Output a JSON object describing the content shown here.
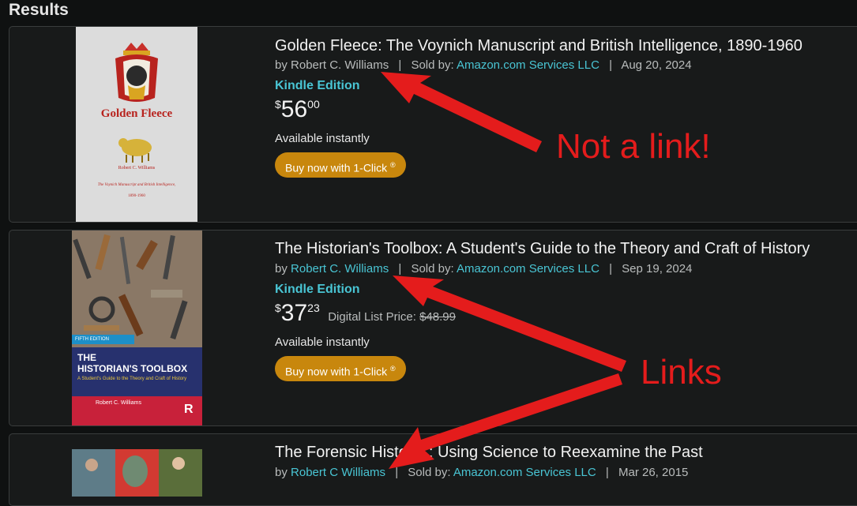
{
  "page": {
    "heading": "Results"
  },
  "results": [
    {
      "title": "Golden Fleece: The Voynich Manuscript and British Intelligence, 1890-1960",
      "by": "by",
      "author": "Robert C. Williams",
      "author_is_link": false,
      "sold_by_label": "Sold by:",
      "seller": "Amazon.com Services LLC",
      "date": "Aug 20, 2024",
      "format": "Kindle Edition",
      "price_symbol": "$",
      "price_whole": "56",
      "price_fraction": "00",
      "availability": "Available instantly",
      "buy_label": "Buy now with 1-Click",
      "buy_reg": "®",
      "cover": {
        "title": "Golden Fleece",
        "author": "Robert C. Williams",
        "subtitle": "The Voynich Manuscript and British Intelligence,",
        "years": "1890-1960"
      }
    },
    {
      "title": "The Historian's Toolbox: A Student's Guide to the Theory and Craft of History",
      "by": "by",
      "author": "Robert C. Williams",
      "author_is_link": true,
      "sold_by_label": "Sold by:",
      "seller": "Amazon.com Services LLC",
      "date": "Sep 19, 2024",
      "format": "Kindle Edition",
      "price_symbol": "$",
      "price_whole": "37",
      "price_fraction": "23",
      "list_price_label": "Digital List Price:",
      "list_price": "$48.99",
      "availability": "Available instantly",
      "buy_label": "Buy now with 1-Click",
      "buy_reg": "®",
      "cover": {
        "edition": "FIFTH EDITION",
        "title_line1": "THE",
        "title_line2": "HISTORIAN'S TOOLBOX",
        "subtitle": "A Student's Guide to the Theory and Craft of History",
        "author": "Robert C. Williams",
        "publisher_mark": "R"
      }
    },
    {
      "title": "The Forensic Historian: Using Science to Reexamine the Past",
      "title_visible_start": "The Forensic Histo",
      "title_visible_end": ": Using Science to Reexamine the Past",
      "by": "by",
      "author": "Robert C Williams",
      "author_is_link": true,
      "sold_by_label": "Sold by:",
      "seller": "Amazon.com Services LLC",
      "date": "Mar 26, 2015"
    }
  ],
  "annotations": {
    "not_a_link": "Not a link!",
    "links": "Links",
    "color": "#e41c1c"
  },
  "colors": {
    "background": "#0f1111",
    "card": "#181a1a",
    "link": "#49c5d4",
    "button": "#c8870d"
  }
}
